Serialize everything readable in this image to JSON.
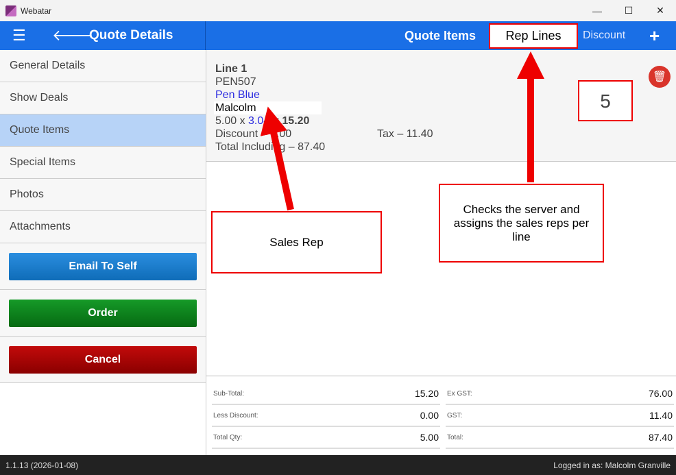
{
  "window": {
    "title": "Webatar",
    "minimize": "—",
    "maximize": "☐",
    "close": "✕"
  },
  "header": {
    "menu_icon": "☰",
    "back_icon": "🡐",
    "title": "Quote Details",
    "quote_items": "Quote Items",
    "rep_lines": "Rep Lines",
    "discount": "Discount",
    "add": "+"
  },
  "sidebar": {
    "items": [
      {
        "label": "General Details"
      },
      {
        "label": "Show Deals"
      },
      {
        "label": "Quote Items",
        "active": true
      },
      {
        "label": "Special Items"
      },
      {
        "label": "Photos"
      },
      {
        "label": "Attachments"
      }
    ],
    "buttons": [
      {
        "label": "Email To Self",
        "color": "#1a7fd0"
      },
      {
        "label": "Order",
        "color": "#0e8a1e"
      },
      {
        "label": "Cancel",
        "color": "#b00000"
      }
    ]
  },
  "line": {
    "title": "Line 1",
    "code": "PEN507",
    "description": "Pen Blue",
    "rep": "Malcolm",
    "qty": "5.00 x ",
    "price": "3.04",
    "amount": " = 15.20",
    "discount": "Discount – 0.00",
    "tax": "Tax – 11.40",
    "total": "Total Including – 87.40",
    "delete_icon": "trash-icon"
  },
  "totals": {
    "left": [
      {
        "label": "Sub-Total:",
        "value": "15.20"
      },
      {
        "label": "Less Discount:",
        "value": "0.00"
      },
      {
        "label": "Total Qty:",
        "value": "5.00"
      }
    ],
    "right": [
      {
        "label": "Ex GST:",
        "value": "76.00"
      },
      {
        "label": "GST:",
        "value": "11.40"
      },
      {
        "label": "Total:",
        "value": "87.40"
      }
    ]
  },
  "footer": {
    "version": "1.1.13 (2026-01-08)",
    "logged_in": "Logged in as: Malcolm Granville"
  },
  "annotations": {
    "count": "5",
    "sales_rep": "Sales Rep",
    "rep_lines_note": "Checks the server and assigns the sales reps per line",
    "color": "#e00000"
  }
}
